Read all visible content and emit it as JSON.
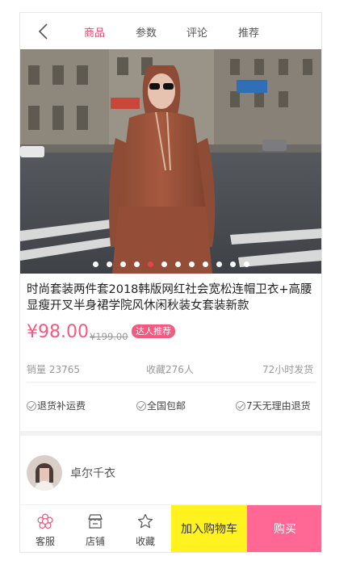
{
  "nav": {
    "tabs": [
      "商品",
      "参数",
      "评论",
      "推荐"
    ],
    "active_tab": "商品"
  },
  "gallery": {
    "image_count": 12,
    "active_index": 4
  },
  "product": {
    "title": "时尚套装两件套2018韩版网红社会宽松连帽卫衣+高腰显瘦开叉半身裙学院风休闲秋装女套装新款",
    "price": "¥98.00",
    "original_price": "¥199.00",
    "badge": "达人推荐"
  },
  "stats": {
    "sales": "销量 23765",
    "favorites": "收藏276人",
    "shipping": "72小时发货"
  },
  "services": [
    "退货补运费",
    "全国包邮",
    "7天无理由退货"
  ],
  "shop": {
    "name": "卓尔千衣"
  },
  "bottom_bar": {
    "service_label": "客服",
    "store_label": "店铺",
    "favorite_label": "收藏",
    "cart_label": "加入购物车",
    "buy_label": "购买"
  },
  "colors": {
    "accent": "#f25b7f",
    "cart_button": "#fff21f",
    "buy_button": "#ff6894",
    "active_dot": "#e8434c"
  }
}
